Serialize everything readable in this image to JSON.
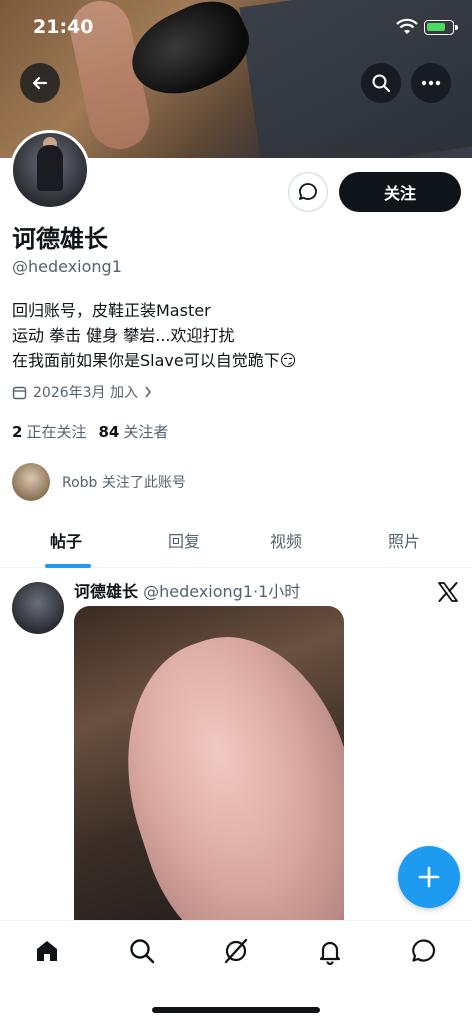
{
  "status_bar": {
    "time": "21:40"
  },
  "profile": {
    "name": "诃德雄长",
    "handle": "@hedexiong1",
    "bio": [
      "回归账号，皮鞋正装Master",
      "运动 拳击 健身 攀岩...欢迎打扰",
      "在我面前如果你是Slave可以自觉跪下😏"
    ],
    "joined": "2026年3月 加入",
    "following_count": "2",
    "following_label": "正在关注",
    "followers_count": "84",
    "followers_label": "关注者",
    "followed_by": "Robb 关注了此账号"
  },
  "actions": {
    "follow_label": "关注"
  },
  "tabs": [
    {
      "label": "帖子",
      "active": true
    },
    {
      "label": "回复",
      "active": false
    },
    {
      "label": "视频",
      "active": false
    },
    {
      "label": "照片",
      "active": false
    }
  ],
  "post": {
    "author": "诃德雄长",
    "handle_time": "@hedexiong1·1小时"
  },
  "icons": {
    "back": "back-arrow-icon",
    "search": "search-icon",
    "more": "more-icon",
    "message": "message-icon",
    "calendar": "calendar-icon",
    "x_logo": "x-logo-icon",
    "compose": "plus-icon",
    "nav": [
      "home-icon",
      "search-icon",
      "grok-icon",
      "notifications-icon",
      "messages-icon"
    ]
  },
  "colors": {
    "accent": "#1d9bf0",
    "text": "#0f1419",
    "secondary": "#536471"
  }
}
